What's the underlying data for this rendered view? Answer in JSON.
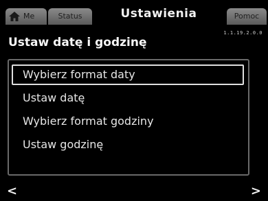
{
  "tabs": {
    "home_label": "Me",
    "status_label": "Status",
    "active_label": "Ustawienia",
    "help_label": "Pomoc"
  },
  "header": {
    "title": "Ustaw datę i godzinę",
    "version": "1.1.19.2.0.0"
  },
  "menu": {
    "items": [
      {
        "label": "Wybierz format daty",
        "selected": true
      },
      {
        "label": "Ustaw datę",
        "selected": false
      },
      {
        "label": "Wybierz format godziny",
        "selected": false
      },
      {
        "label": "Ustaw godzinę",
        "selected": false
      }
    ]
  },
  "nav": {
    "left": "<",
    "right": ">"
  },
  "icons": {
    "home": "home-icon"
  },
  "colors": {
    "background": "#000000",
    "inactive_tab": "#7a7a7a",
    "text": "#ffffff",
    "panel_border": "#6a6a6a"
  }
}
